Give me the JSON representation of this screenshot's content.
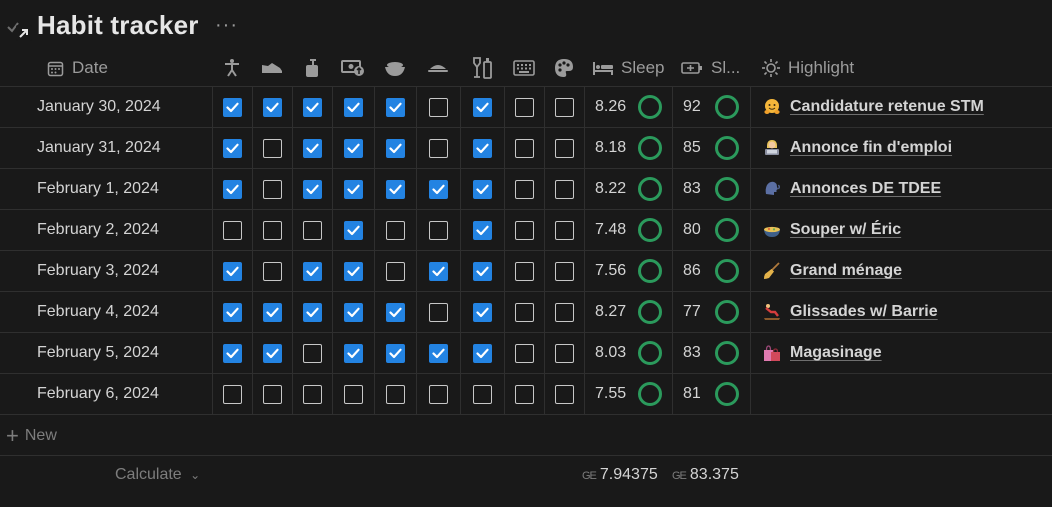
{
  "title": "Habit tracker",
  "more": "···",
  "columns": {
    "date": "Date",
    "sleep": "Sleep",
    "sleep_score": "Sl...",
    "highlight": "Highlight"
  },
  "habit_icons": [
    "stretch-figure-icon",
    "shoe-icon",
    "soap-bottle-icon",
    "money-icon",
    "bowl-icon",
    "dish-icon",
    "bottles-icon",
    "keyboard-icon",
    "palette-icon"
  ],
  "rows": [
    {
      "date": "January 30, 2024",
      "checks": [
        true,
        true,
        true,
        true,
        true,
        false,
        true,
        false,
        false
      ],
      "sleep": "8.26",
      "score": "92",
      "highlight": "Candidature retenue STM",
      "emoji": "hugging-face-icon"
    },
    {
      "date": "January 31, 2024",
      "checks": [
        true,
        false,
        true,
        true,
        true,
        false,
        true,
        false,
        false
      ],
      "sleep": "8.18",
      "score": "85",
      "highlight": "Annonce fin d'emploi",
      "emoji": "person-laptop-icon"
    },
    {
      "date": "February 1, 2024",
      "checks": [
        true,
        false,
        true,
        true,
        true,
        true,
        true,
        false,
        false
      ],
      "sleep": "8.22",
      "score": "83",
      "highlight": "Annonces DE TDEE",
      "emoji": "speaking-head-icon"
    },
    {
      "date": "February 2, 2024",
      "checks": [
        false,
        false,
        false,
        true,
        false,
        false,
        true,
        false,
        false
      ],
      "sleep": "7.48",
      "score": "80",
      "highlight": "Souper w/ Éric",
      "emoji": "food-bowl-icon"
    },
    {
      "date": "February 3, 2024",
      "checks": [
        true,
        false,
        true,
        true,
        false,
        true,
        true,
        false,
        false
      ],
      "sleep": "7.56",
      "score": "86",
      "highlight": "Grand ménage",
      "emoji": "broom-icon"
    },
    {
      "date": "February 4, 2024",
      "checks": [
        true,
        true,
        true,
        true,
        true,
        false,
        true,
        false,
        false
      ],
      "sleep": "8.27",
      "score": "77",
      "highlight": "Glissades w/ Barrie",
      "emoji": "sled-icon"
    },
    {
      "date": "February 5, 2024",
      "checks": [
        true,
        true,
        false,
        true,
        true,
        true,
        true,
        false,
        false
      ],
      "sleep": "8.03",
      "score": "83",
      "highlight": "Magasinage",
      "emoji": "shopping-bags-icon"
    },
    {
      "date": "February 6, 2024",
      "checks": [
        false,
        false,
        false,
        false,
        false,
        false,
        false,
        false,
        false
      ],
      "sleep": "7.55",
      "score": "81",
      "highlight": "",
      "emoji": ""
    }
  ],
  "new_label": "New",
  "calculate_label": "Calculate",
  "sleep_average_label": "GE",
  "sleep_average": "7.94375",
  "score_average_label": "GE",
  "score_average": "83.375",
  "colors": {
    "background": "#191919",
    "checkbox_on": "#2383e2",
    "ring": "#2b9a5c",
    "text": "#d4d4d4",
    "muted": "#9b9b9b"
  }
}
